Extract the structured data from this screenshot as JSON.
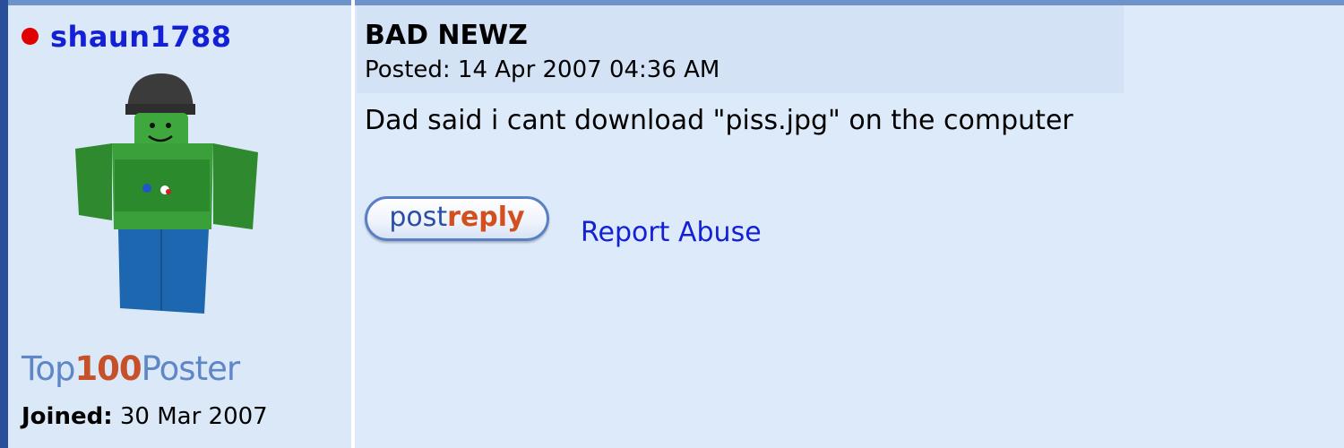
{
  "author": {
    "username": "shaun1788",
    "status_color": "#e00000",
    "rank": {
      "part1": "Top",
      "part2": "100",
      "part3": "Poster"
    },
    "joined_label": "Joined:",
    "joined_value": " 30 Mar 2007"
  },
  "post": {
    "title": "BAD NEWZ",
    "posted": "Posted: 14 Apr 2007 04:36 AM",
    "body": "Dad said i cant download \"piss.jpg\" on the computer"
  },
  "actions": {
    "reply_part1": "post",
    "reply_part2": "reply",
    "report_label": "Report Abuse"
  }
}
